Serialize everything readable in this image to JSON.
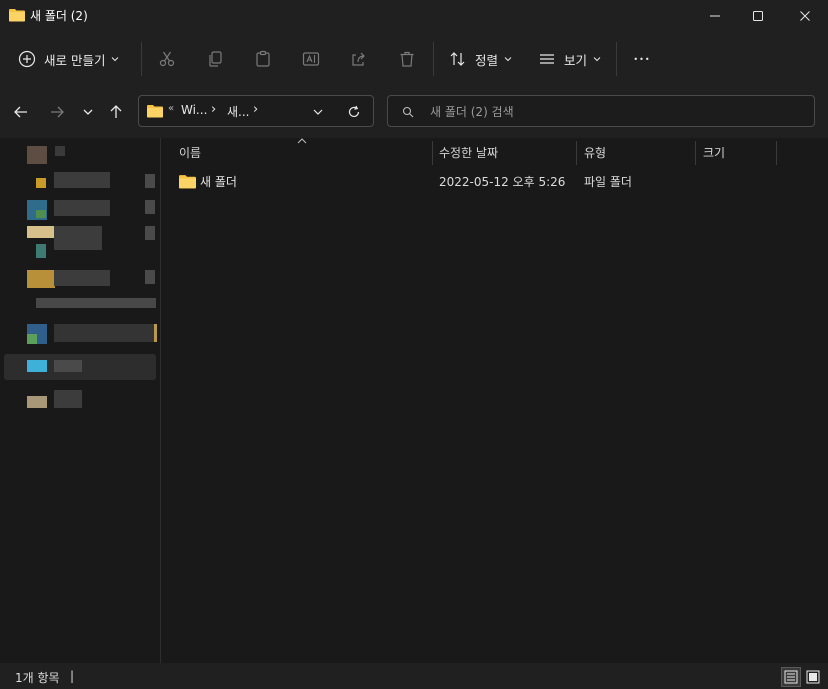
{
  "window": {
    "title": "새 폴더 (2)",
    "minimize_glyph": "—",
    "maximize_glyph": "☐",
    "close_glyph": "✕"
  },
  "toolbar": {
    "new_label": "새로 만들기",
    "sort_label": "정렬",
    "view_label": "보기",
    "more_glyph": "•••"
  },
  "address": {
    "overflow_glyph": "«",
    "segments": [
      "Wi...",
      "새..."
    ],
    "separator": "›"
  },
  "search": {
    "placeholder": "새 폴더 (2) 검색"
  },
  "columns": {
    "name": "이름",
    "modified": "수정한 날짜",
    "type": "유형",
    "size": "크기"
  },
  "files": [
    {
      "name": "새 폴더",
      "modified": "2022-05-12 오후 5:26",
      "type": "파일 폴더",
      "size": ""
    }
  ],
  "status": {
    "item_count": "1개 항목",
    "cursor": "|"
  },
  "colors": {
    "folder": "#f7c244",
    "background": "#191919",
    "chrome": "#202020"
  }
}
